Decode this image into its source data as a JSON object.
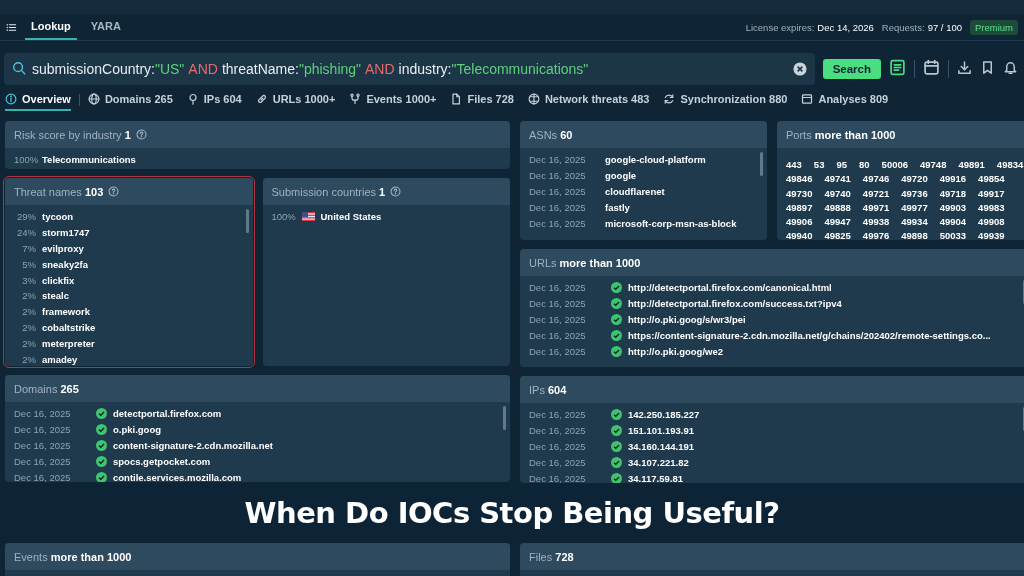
{
  "top_bar": {
    "tabs": [
      {
        "label": "Lookup",
        "selected": true
      },
      {
        "label": "YARA",
        "selected": false
      }
    ],
    "license_label": "License expires:",
    "license_date": "Dec 14, 2026",
    "requests_label": "Requests:",
    "requests_value": "97 / 100",
    "plan_badge": "Premium"
  },
  "search": {
    "query_parts": [
      {
        "text": "submissionCountry:",
        "kind": "key"
      },
      {
        "text": "\"US\"",
        "kind": "value"
      },
      {
        "text": "AND",
        "kind": "operator"
      },
      {
        "text": "threatName:",
        "kind": "key"
      },
      {
        "text": "\"phishing\"",
        "kind": "value"
      },
      {
        "text": "AND",
        "kind": "operator"
      },
      {
        "text": "industry:",
        "kind": "key"
      },
      {
        "text": "\"Telecommunications\"",
        "kind": "value"
      }
    ],
    "button": "Search"
  },
  "nav_tabs": [
    {
      "label": "Overview",
      "selected": true
    },
    {
      "label": "Domains 265",
      "selected": false
    },
    {
      "label": "IPs 604",
      "selected": false
    },
    {
      "label": "URLs 1000+",
      "selected": false
    },
    {
      "label": "Events 1000+",
      "selected": false
    },
    {
      "label": "Files 728",
      "selected": false
    },
    {
      "label": "Network threats 483",
      "selected": false
    },
    {
      "label": "Synchronization 880",
      "selected": false
    },
    {
      "label": "Analyses 809",
      "selected": false
    }
  ],
  "risk_score": {
    "title": "Risk score by industry **1**",
    "rows": [
      {
        "percent": "100%",
        "name": "Telecommunications"
      }
    ]
  },
  "threat_names": {
    "title": "Threat names **103**",
    "highlighted": true,
    "rows": [
      {
        "percent": "29%",
        "name": "tycoon"
      },
      {
        "percent": "24%",
        "name": "storm1747"
      },
      {
        "percent": "7%",
        "name": "evilproxy"
      },
      {
        "percent": "5%",
        "name": "sneaky2fa"
      },
      {
        "percent": "3%",
        "name": "clickfix"
      },
      {
        "percent": "2%",
        "name": "stealc"
      },
      {
        "percent": "2%",
        "name": "framework"
      },
      {
        "percent": "2%",
        "name": "cobaltstrike"
      },
      {
        "percent": "2%",
        "name": "meterpreter"
      },
      {
        "percent": "2%",
        "name": "amadey"
      }
    ]
  },
  "submission_countries": {
    "title": "Submission countries **1**",
    "rows": [
      {
        "percent": "100%",
        "name": "United States"
      }
    ]
  },
  "asns": {
    "title": "ASNs **60**",
    "rows": [
      {
        "date": "Dec 16, 2025",
        "name": "google-cloud-platform"
      },
      {
        "date": "Dec 16, 2025",
        "name": "google"
      },
      {
        "date": "Dec 16, 2025",
        "name": "cloudflarenet"
      },
      {
        "date": "Dec 16, 2025",
        "name": "fastly"
      },
      {
        "date": "Dec 16, 2025",
        "name": "microsoft-corp-msn-as-block"
      }
    ]
  },
  "ports": {
    "title": "Ports **more than 1000**",
    "values": [
      "443",
      "53",
      "95",
      "80",
      "50006",
      "49748",
      "49891",
      "49834",
      "49846",
      "49741",
      "49746",
      "49720",
      "49916",
      "49854",
      "49730",
      "49740",
      "49721",
      "49736",
      "49718",
      "49917",
      "49897",
      "49888",
      "49971",
      "49977",
      "49903",
      "49983",
      "49906",
      "49947",
      "49938",
      "49934",
      "49904",
      "49908",
      "49940",
      "49825",
      "49976",
      "49898",
      "50033",
      "49939"
    ]
  },
  "urls": {
    "title": "URLs **more than 1000**",
    "rows": [
      {
        "date": "Dec 16, 2025",
        "value": "http://detectportal.firefox.com/canonical.html"
      },
      {
        "date": "Dec 16, 2025",
        "value": "http://detectportal.firefox.com/success.txt?ipv4"
      },
      {
        "date": "Dec 16, 2025",
        "value": "http://o.pki.goog/s/wr3/pei"
      },
      {
        "date": "Dec 16, 2025",
        "value": "https://content-signature-2.cdn.mozilla.net/g/chains/202402/remote-settings.co..."
      },
      {
        "date": "Dec 16, 2025",
        "value": "http://o.pki.goog/we2"
      }
    ]
  },
  "domains": {
    "title": "Domains **265**",
    "rows": [
      {
        "date": "Dec 16, 2025",
        "value": "detectportal.firefox.com"
      },
      {
        "date": "Dec 16, 2025",
        "value": "o.pki.goog"
      },
      {
        "date": "Dec 16, 2025",
        "value": "content-signature-2.cdn.mozilla.net"
      },
      {
        "date": "Dec 16, 2025",
        "value": "spocs.getpocket.com"
      },
      {
        "date": "Dec 16, 2025",
        "value": "contile.services.mozilla.com"
      }
    ]
  },
  "ips": {
    "title": "IPs **604**",
    "rows": [
      {
        "date": "Dec 16, 2025",
        "value": "142.250.185.227"
      },
      {
        "date": "Dec 16, 2025",
        "value": "151.101.193.91"
      },
      {
        "date": "Dec 16, 2025",
        "value": "34.160.144.191"
      },
      {
        "date": "Dec 16, 2025",
        "value": "34.107.221.82"
      },
      {
        "date": "Dec 16, 2025",
        "value": "34.117.59.81"
      }
    ]
  },
  "banner": {
    "title": "When Do IOCs Stop Being Useful?"
  },
  "events": {
    "title": "Events **more than 1000**"
  },
  "files": {
    "title": "Files **728**"
  }
}
